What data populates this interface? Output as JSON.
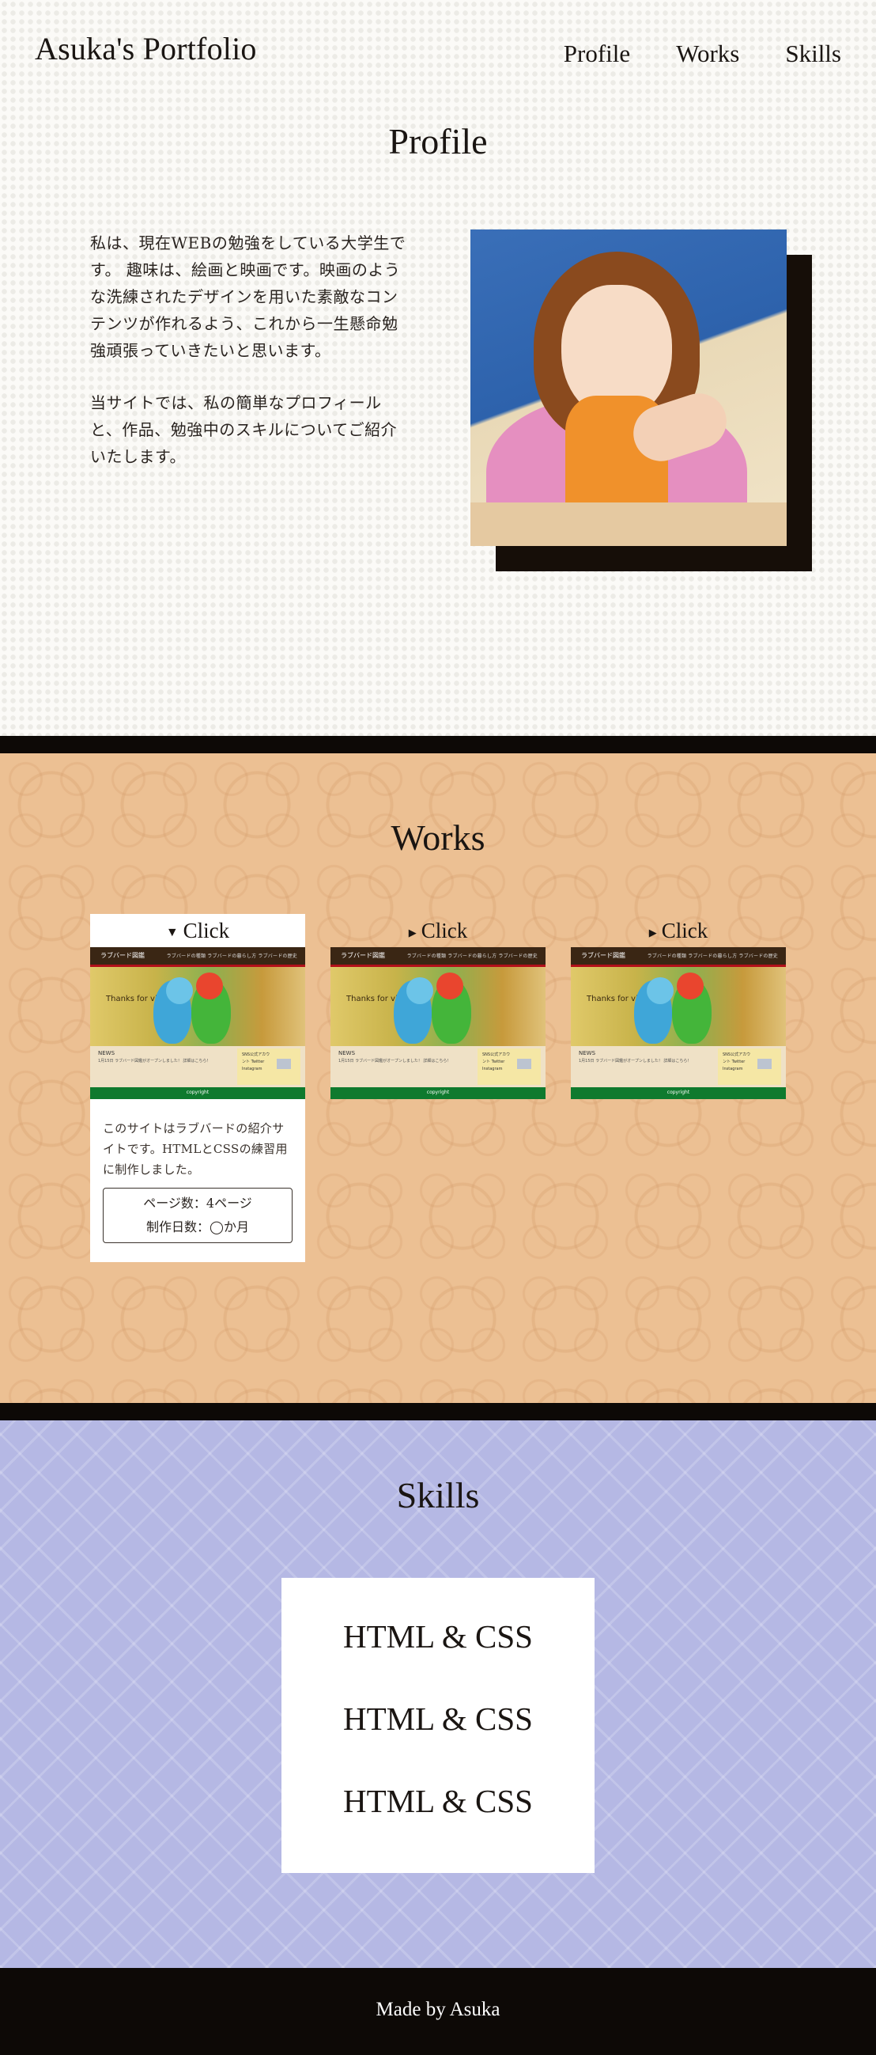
{
  "header": {
    "site_title": "Asuka's Portfolio",
    "nav": [
      {
        "label": "Profile"
      },
      {
        "label": "Works"
      },
      {
        "label": "Skills"
      }
    ]
  },
  "profile": {
    "title": "Profile",
    "paragraphs": [
      "私は、現在WEBの勉強をしている大学生です。 趣味は、絵画と映画です。映画のような洗練されたデザインを用いた素敵なコンテンツが作れるよう、これから一生懸命勉強頑張っていきたいと思います。",
      "当サイトでは、私の簡単なプロフィールと、作品、勉強中のスキルについてご紹介いたします。"
    ]
  },
  "works": {
    "title": "Works",
    "thumbnail": {
      "site_name": "ラブバード図鑑",
      "nav_links": "ラブバードの種類   ラブバードの暮らし方   ラブバードの歴史",
      "welcome": "Thanks for visiting !",
      "news_heading": "NEWS",
      "news_text": "1月15日    ラブバード図鑑がオープンしました！ 詳細はこちら！",
      "side_text": "SNS公式アカウント Twitter Instagram",
      "footer": "copyright"
    },
    "cards": [
      {
        "summary": "Click",
        "open": true,
        "description": "このサイトはラブバードの紹介サイトです。HTMLとCSSの練習用に制作しました。",
        "pages": "ページ数：4ページ",
        "duration": "制作日数：◯か月"
      },
      {
        "summary": "Click",
        "open": false
      },
      {
        "summary": "Click",
        "open": false
      }
    ]
  },
  "skills": {
    "title": "Skills",
    "items": [
      "HTML & CSS",
      "HTML & CSS",
      "HTML & CSS"
    ]
  },
  "footer": {
    "text": "Made by Asuka"
  },
  "colors": {
    "dark": "#0d0906",
    "works_bg": "#ecc093",
    "skills_bg": "#b5b8e4",
    "thumb_footer": "#0f7a2e"
  }
}
